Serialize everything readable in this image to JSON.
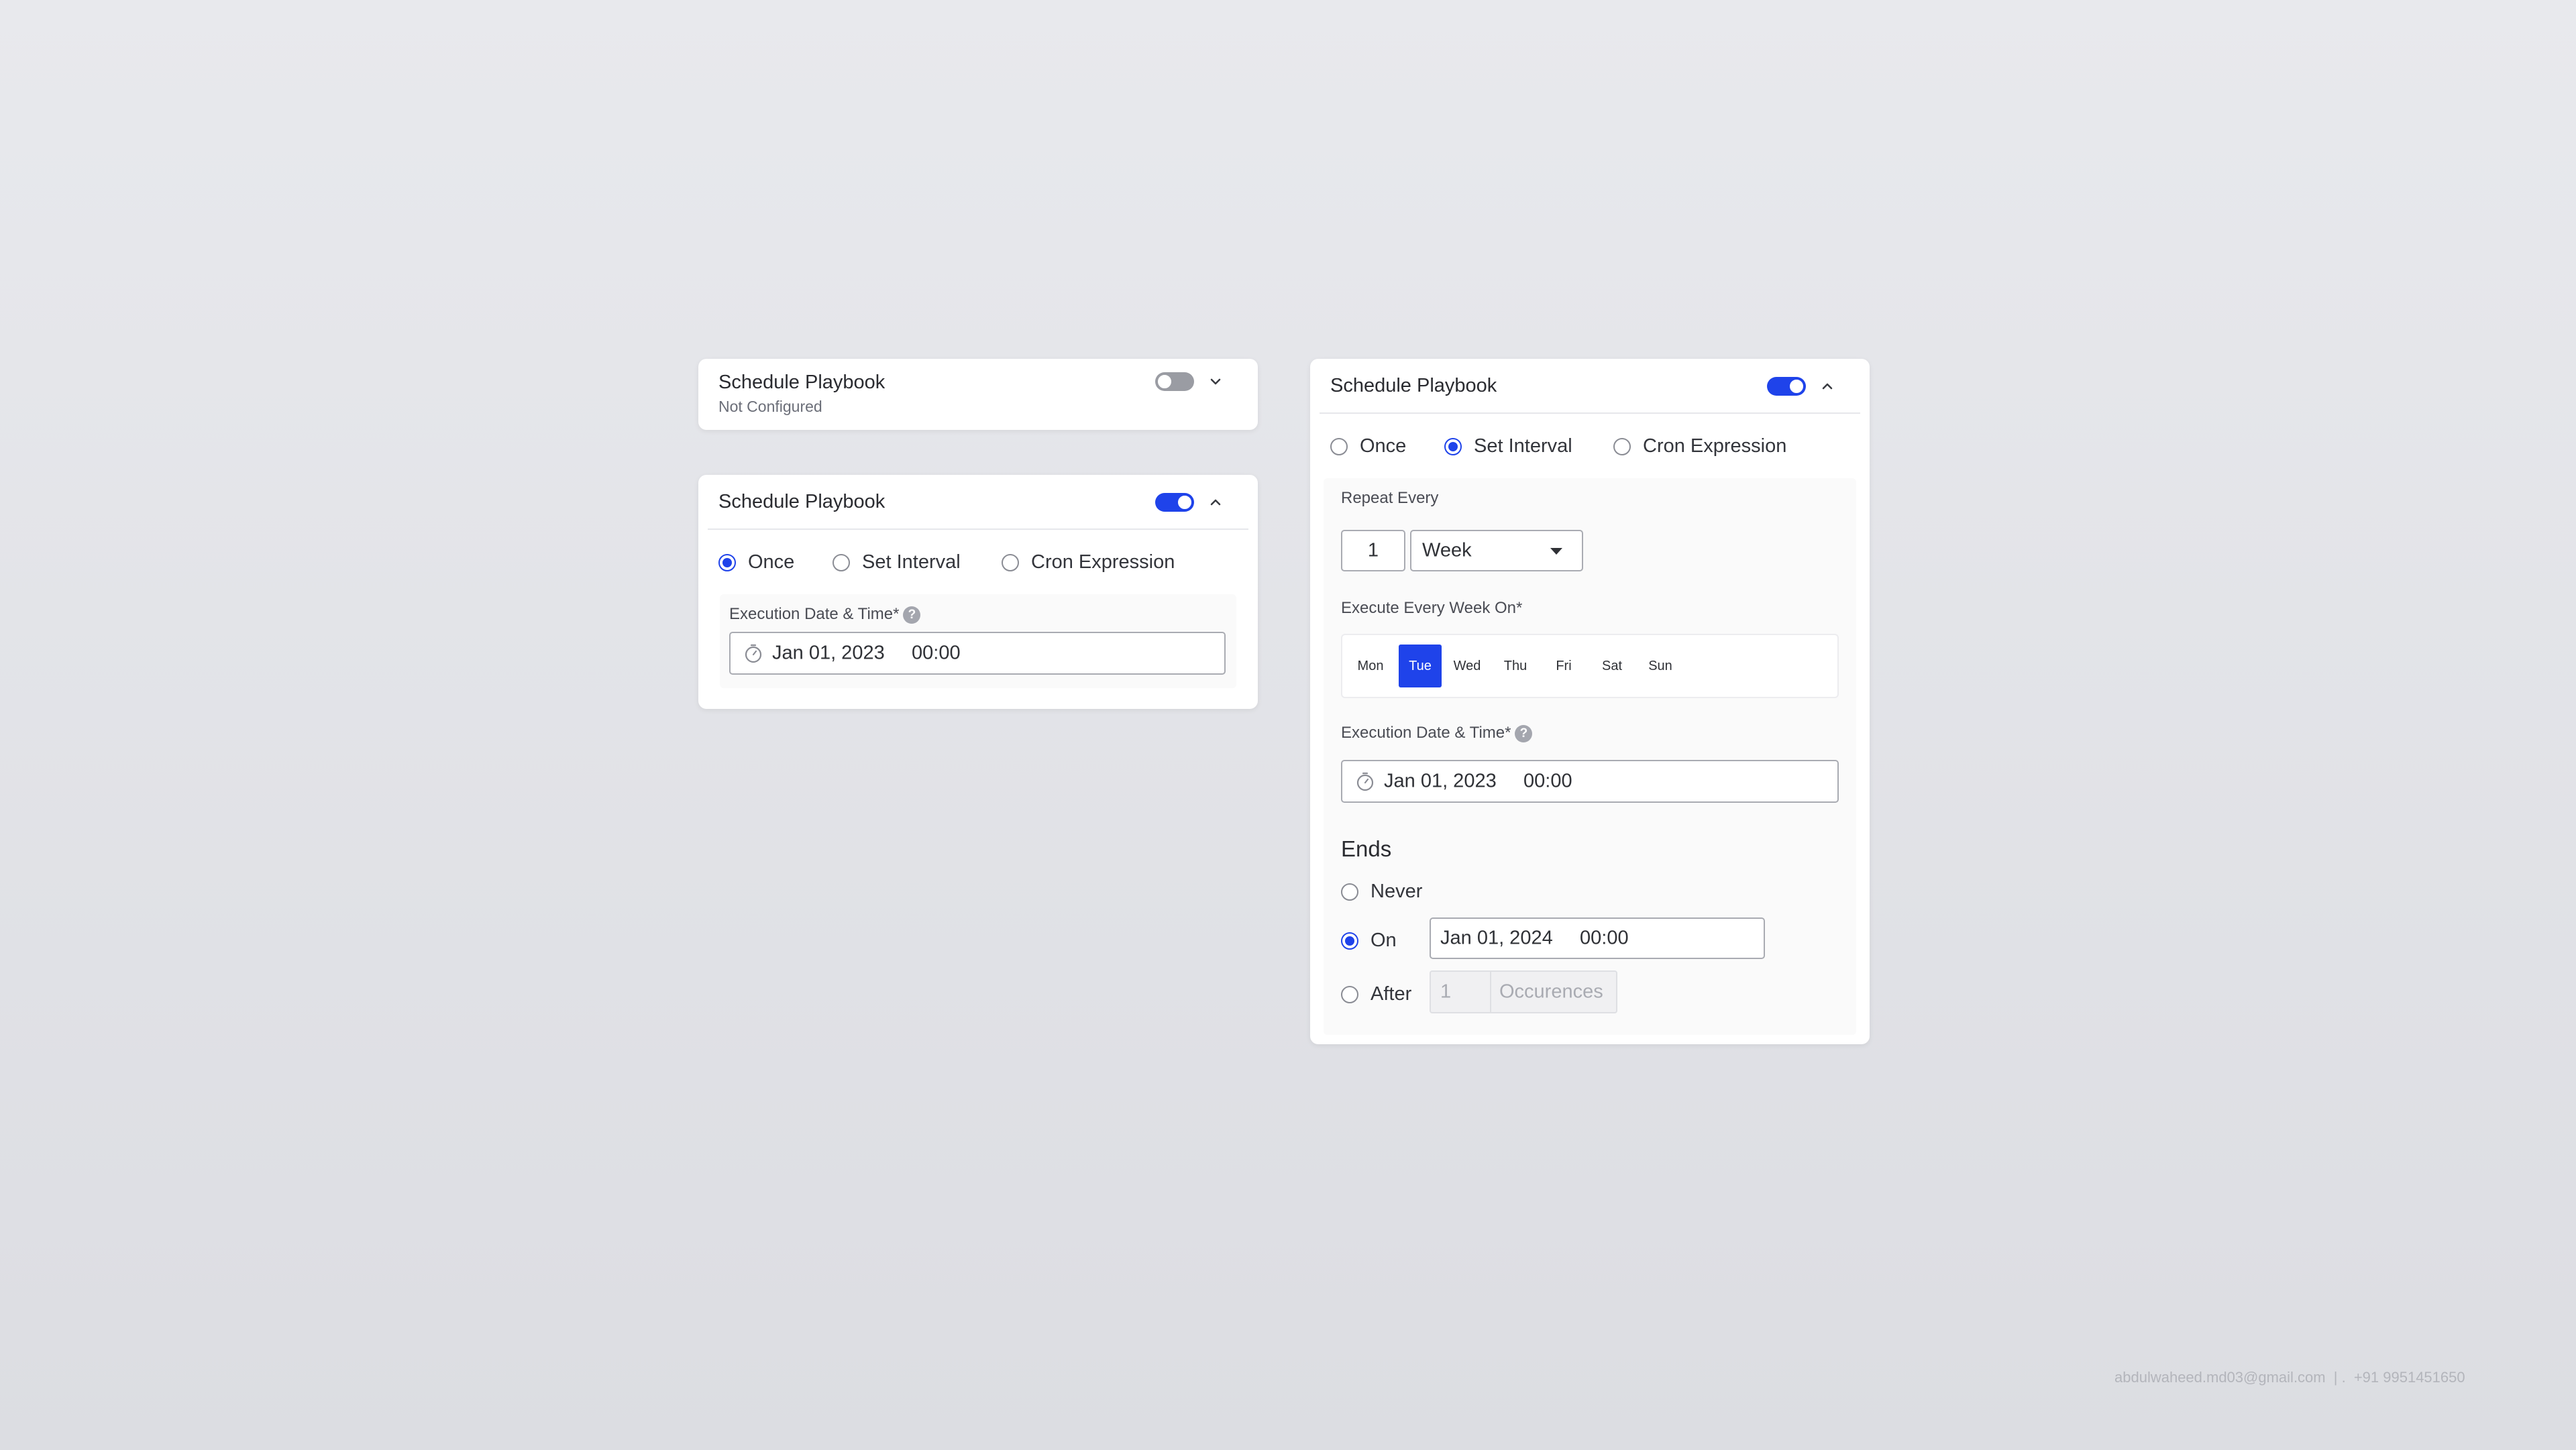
{
  "cards": {
    "collapsed": {
      "title": "Schedule Playbook",
      "status": "Not Configured",
      "toggle_on": false
    },
    "once": {
      "title": "Schedule Playbook",
      "toggle_on": true,
      "modes": [
        "Once",
        "Set Interval",
        "Cron Expression"
      ],
      "selected_mode": "Once",
      "execution_label": "Execution Date & Time*",
      "execution_date": "Jan 01, 2023",
      "execution_time": "00:00"
    },
    "interval": {
      "title": "Schedule Playbook",
      "toggle_on": true,
      "modes": [
        "Once",
        "Set Interval",
        "Cron Expression"
      ],
      "selected_mode": "Set Interval",
      "repeat_label": "Repeat Every",
      "repeat_count": "1",
      "repeat_unit": "Week",
      "week_label": "Execute Every Week On*",
      "days": [
        "Mon",
        "Tue",
        "Wed",
        "Thu",
        "Fri",
        "Sat",
        "Sun"
      ],
      "selected_day": "Tue",
      "execution_label": "Execution Date & Time*",
      "execution_date": "Jan 01, 2023",
      "execution_time": "00:00",
      "ends": {
        "title": "Ends",
        "options": [
          "Never",
          "On",
          "After"
        ],
        "selected": "On",
        "on_date": "Jan 01, 2024",
        "on_time": "00:00",
        "after_count": "1",
        "after_unit": "Occurences"
      }
    }
  },
  "help_glyph": "?",
  "footer": {
    "email": "abdulwaheed.md03@gmail.com",
    "separator": "| .",
    "phone": "+91 9951451650"
  },
  "colors": {
    "accent": "#1f43ea",
    "toggle_off": "#9a9ca3"
  }
}
